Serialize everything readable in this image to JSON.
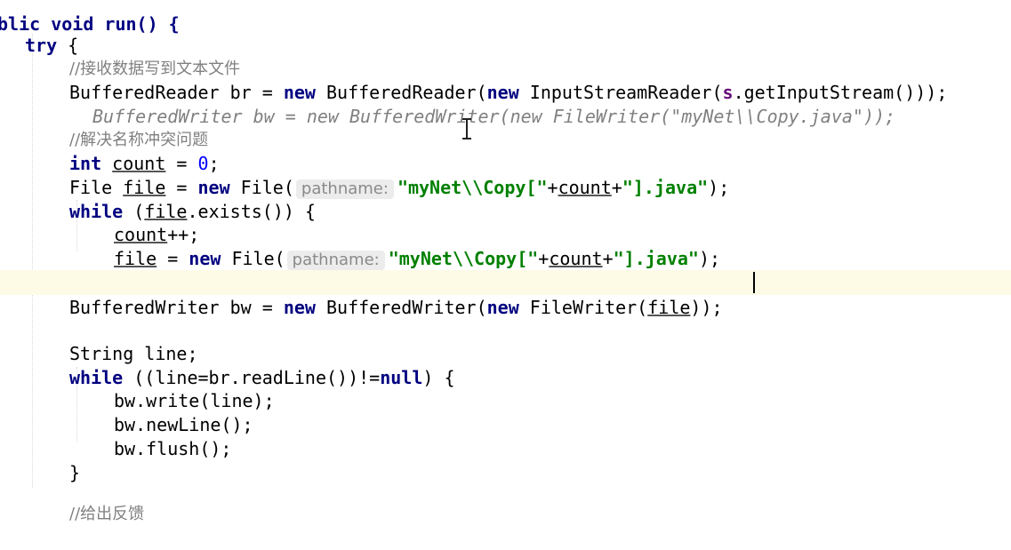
{
  "code": {
    "l0": "blic void run() {",
    "l1_kw": "try",
    "l1_rest": " {",
    "l2": "//接收数据写到文本文件",
    "l3": {
      "a": "BufferedReader br = ",
      "new1": "new",
      "b": " BufferedReader(",
      "new2": "new",
      "c": " InputStreamReader(",
      "s": "s",
      "d": ".getInputStream()));"
    },
    "l4": "BufferedWriter bw = new BufferedWriter(new FileWriter(\"myNet\\\\Copy.java\"));",
    "l5": "//解决名称冲突问题",
    "l6": {
      "kw": "int",
      "var": "count",
      "eq": " = ",
      "num": "0",
      "end": ";"
    },
    "l7": {
      "a": "File ",
      "var": "file",
      "b": " = ",
      "new": "new",
      "c": " File(",
      "hint": "pathname:",
      "str1": "\"myNet\\\\Copy[\"",
      "plus1": "+",
      "var2": "count",
      "plus2": "+",
      "str2": "\"].java\"",
      "end": ");"
    },
    "l8": {
      "kw": "while",
      "a": " (",
      "var": "file",
      "b": ".exists()) {"
    },
    "l9": {
      "var": "count",
      "end": "++;"
    },
    "l10": {
      "var": "file",
      "b": " = ",
      "new": "new",
      "c": " File(",
      "hint": "pathname:",
      "str1": "\"myNet\\\\Copy[\"",
      "plus1": "+",
      "var2": "count",
      "plus2": "+",
      "str2": "\"].java\"",
      "end": ");"
    },
    "l11": "}",
    "l12": {
      "a": "BufferedWriter bw = ",
      "new1": "new",
      "b": " BufferedWriter(",
      "new2": "new",
      "c": " FileWriter(",
      "var": "file",
      "end": "));"
    },
    "l14": "String line;",
    "l15": {
      "kw": "while",
      "a": " ((line=br.readLine())!=",
      "null": "null",
      "b": ") {"
    },
    "l16": "bw.write(line);",
    "l17": "bw.newLine();",
    "l18": "bw.flush();",
    "l19": "}",
    "l21": "//给出反馈"
  },
  "colors": {
    "keyword": "#000080",
    "string": "#008000",
    "comment": "#808080",
    "number": "#0000ff",
    "current_line": "#fdfbe6",
    "hint_bg": "#ececec"
  }
}
